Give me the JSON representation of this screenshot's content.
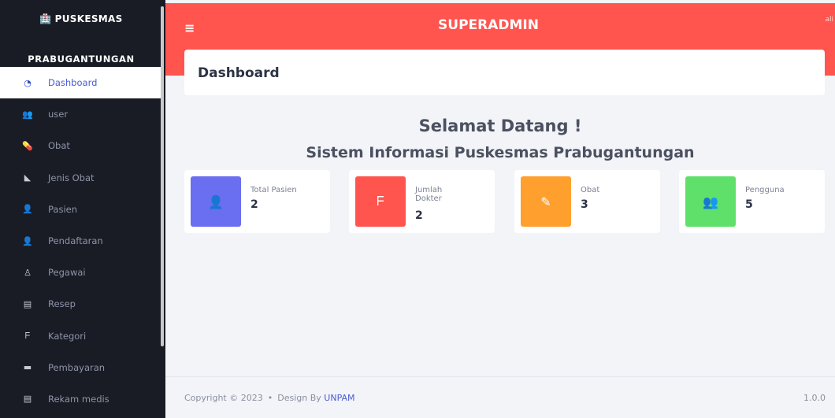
{
  "sidebar": {
    "brand_icon": "🏥",
    "brand_title": "PUSKESMAS",
    "brand_subtitle": "PRABUGANTUNGAN",
    "items": [
      {
        "label": "Dashboard",
        "icon": "tachometer-icon",
        "glyph": "◔",
        "active": true
      },
      {
        "label": "user",
        "icon": "users-icon",
        "glyph": "👥",
        "active": false
      },
      {
        "label": "Obat",
        "icon": "pills-icon",
        "glyph": "💊",
        "active": false
      },
      {
        "label": "Jenis Obat",
        "icon": "mortar-icon",
        "glyph": "◣",
        "active": false
      },
      {
        "label": "Pasien",
        "icon": "user-shield-icon",
        "glyph": "👤",
        "active": false
      },
      {
        "label": "Pendaftaran",
        "icon": "user-plus-icon",
        "glyph": "👤",
        "active": false
      },
      {
        "label": "Pegawai",
        "icon": "user-tie-icon",
        "glyph": "♙",
        "active": false
      },
      {
        "label": "Resep",
        "icon": "file-icon",
        "glyph": "▤",
        "active": false
      },
      {
        "label": "Kategori",
        "icon": "stethoscope-icon",
        "glyph": "ᖴ",
        "active": false
      },
      {
        "label": "Pembayaran",
        "icon": "money-icon",
        "glyph": "▬",
        "active": false
      },
      {
        "label": "Rekam medis",
        "icon": "file-medical-icon",
        "glyph": "▤",
        "active": false
      }
    ]
  },
  "topbar": {
    "menu_glyph": "≡",
    "title": "SUPERADMIN",
    "user": "ali"
  },
  "header": {
    "title": "Dashboard"
  },
  "welcome": {
    "line1": "Selamat Datang !",
    "line2": "Sistem Informasi Puskesmas Prabugantungan"
  },
  "stats": [
    {
      "label": "Total Pasien",
      "value": "2",
      "color": "#6a6ef0",
      "icon": "user-shield-icon",
      "glyph": "👤"
    },
    {
      "label": "Jumlah Dokter",
      "value": "2",
      "color": "#ff554e",
      "icon": "stethoscope-icon",
      "glyph": "ᖴ"
    },
    {
      "label": "Obat",
      "value": "3",
      "color": "#ff9f2d",
      "icon": "eyedropper-icon",
      "glyph": "✎"
    },
    {
      "label": "Pengguna",
      "value": "5",
      "color": "#5fe06a",
      "icon": "users-icon",
      "glyph": "👥"
    }
  ],
  "footer": {
    "copyright": "Copyright © 2023",
    "dot": "•",
    "design_by": "Design By",
    "design_link": "UNPAM",
    "version": "1.0.0"
  },
  "colors": {
    "sidebar_bg": "#191c24",
    "topbar_bg": "#ff554e",
    "accent": "#4a5bd6",
    "content_bg": "#f3f4f8"
  }
}
